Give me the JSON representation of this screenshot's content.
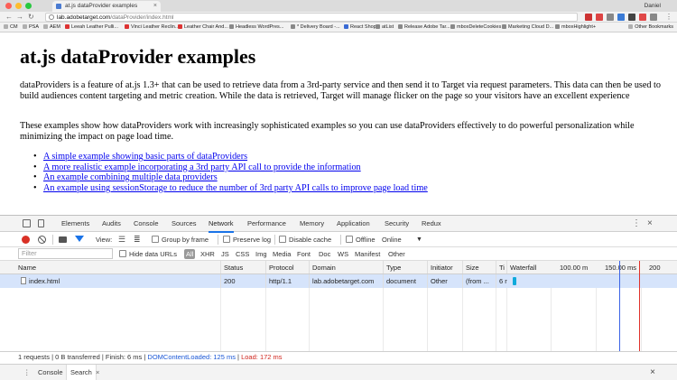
{
  "browser": {
    "tab_title": "at.js dataProvider examples",
    "profile_name": "Daniel",
    "url_host": "lab.adobetarget.com",
    "url_path": "/dataProvider/index.html",
    "bookmarks": [
      "CM",
      "PSA",
      "AEM",
      "Leeah Leather Pulli...",
      "Vinci Leather Reclin...",
      "Leather Chair And...",
      "Headless WordPres...",
      "* Delivery Board -...",
      "React Shop",
      "atList",
      "Release Adobe Tar...",
      "mboxDeleteCookies",
      "Marketing Cloud D...",
      "mboxHighlight+"
    ],
    "other_bookmarks": "Other Bookmarks"
  },
  "page": {
    "title": "at.js dataProvider examples",
    "intro": "dataProviders is a feature of at.js 1.3+ that can be used to retrieve data from a 3rd-party service and then send it to Target via request parameters. This data can then be used to build audiences content targeting and metric creation. While the data is retrieved, Target will manage flicker on the page so your visitors have an excellent experience",
    "desc": "These examples show how dataProviders work with increasingly sophisticated examples so you can use dataProviders effectively to do powerful personalization while minimizing the impact on page load time.",
    "links": [
      "A simple example showing basic parts of dataProviders",
      "A more realistic example incorporating a 3rd party API call to provide the information",
      "An example combining multiple data providers",
      "An example using sessionStorage to reduce the number of 3rd party API calls to improve page load time"
    ]
  },
  "devtools": {
    "tabs": [
      "Elements",
      "Audits",
      "Console",
      "Sources",
      "Network",
      "Performance",
      "Memory",
      "Application",
      "Security",
      "Redux"
    ],
    "active_tab": "Network",
    "toolbar": {
      "view_label": "View:",
      "group_by_frame": "Group by frame",
      "preserve_log": "Preserve log",
      "disable_cache": "Disable cache",
      "offline": "Offline",
      "throttle": "Online"
    },
    "filter_placeholder": "Filter",
    "hide_data_urls": "Hide data URLs",
    "types": [
      "All",
      "XHR",
      "JS",
      "CSS",
      "Img",
      "Media",
      "Font",
      "Doc",
      "WS",
      "Manifest",
      "Other"
    ],
    "columns": [
      "Name",
      "Status",
      "Protocol",
      "Domain",
      "Type",
      "Initiator",
      "Size",
      "Ti",
      "Waterfall",
      "100.00 m",
      "150.00 ms",
      "200"
    ],
    "rows": [
      {
        "name": "index.html",
        "status": "200",
        "protocol": "http/1.1",
        "domain": "lab.adobetarget.com",
        "type": "document",
        "initiator": "Other",
        "size": "(from ...",
        "time": "6 r"
      }
    ],
    "status": {
      "summary": "1 requests | 0 B transferred | Finish: 6 ms | ",
      "dcl": "DOMContentLoaded: 125 ms",
      "sep": " | ",
      "load": "Load: 172 ms"
    },
    "drawer_tabs": [
      "Console",
      "Search"
    ],
    "drawer_active": "Search"
  }
}
